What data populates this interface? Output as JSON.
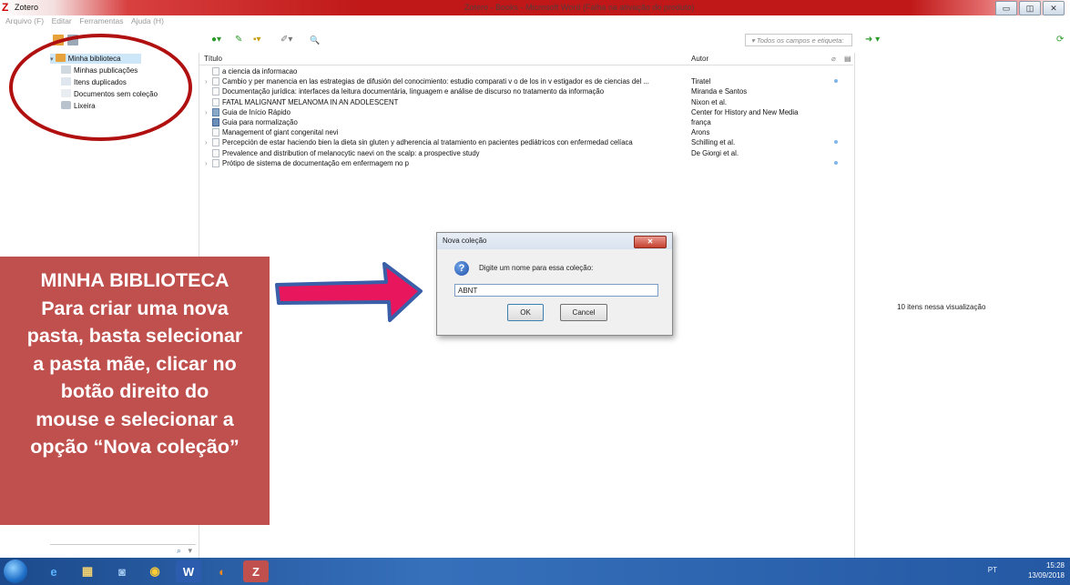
{
  "window": {
    "app_title": "Zotero",
    "doc_title": "Zotero - Books - Microsoft Word (Falha na ativação do produto)",
    "controls": [
      "▭",
      "◫",
      "✕"
    ]
  },
  "menu": [
    "Arquivo (F)",
    "Editar",
    "Ferramentas",
    "Ajuda (H)"
  ],
  "toolbar": {
    "search_placeholder": "▾ Todos os campos e etiqueta:",
    "new_item": "●▾",
    "add_by_id": "✎",
    "new_note": "▪▾",
    "attach": "✐▾",
    "advanced_search": "🔍",
    "sync": "➜ ▾",
    "sync_status": "⟳"
  },
  "library": {
    "root": "Minha biblioteca",
    "items": [
      "Minhas publicações",
      "Itens duplicados",
      "Documentos sem coleção",
      "Lixeira"
    ]
  },
  "columns": {
    "title": "Título",
    "author": "Autor"
  },
  "rows": [
    {
      "title": "a ciencia da informacao",
      "author": "",
      "expand": "",
      "dot": false,
      "icon": "doc"
    },
    {
      "title": "Cambio y per manencia en las estrategias de difusión del conocimiento: estudio comparati v o de los in v estigador es de ciencias del ...",
      "author": "Tiratel",
      "expand": "›",
      "dot": true,
      "icon": "doc"
    },
    {
      "title": "Documentação jurídica: interfaces da leitura documentária, linguagem e análise de discurso no tratamento da informação",
      "author": "Miranda e Santos",
      "expand": "",
      "dot": false,
      "icon": "doc"
    },
    {
      "title": "FATAL MALIGNANT MELANOMA IN AN ADOLESCENT",
      "author": "Nixon et al.",
      "expand": "",
      "dot": false,
      "icon": "doc"
    },
    {
      "title": "Guia de Início Rápido",
      "author": "Center for History and New Media",
      "expand": "›",
      "dot": false,
      "icon": "book"
    },
    {
      "title": "Guia para normalização",
      "author": "frança",
      "expand": "",
      "dot": false,
      "icon": "doc2"
    },
    {
      "title": "Management of giant congenital nevi",
      "author": "Arons",
      "expand": "",
      "dot": false,
      "icon": "doc"
    },
    {
      "title": "Percepción de estar haciendo bien la dieta sin gluten y adherencia al tratamiento en pacientes pediátricos con enfermedad celíaca",
      "author": "Schilling et al.",
      "expand": "›",
      "dot": true,
      "icon": "doc"
    },
    {
      "title": "Prevalence and distribution of melanocytic naevi on the scalp: a prospective study",
      "author": "De Giorgi et al.",
      "expand": "",
      "dot": false,
      "icon": "doc"
    },
    {
      "title": "Prótipo de sistema de documentação em enfermagem no p",
      "author": "",
      "expand": "›",
      "dot": true,
      "icon": "doc"
    }
  ],
  "right_pane": {
    "count": "10 itens nessa visualização"
  },
  "dialog": {
    "title": "Nova coleção",
    "close": "✕",
    "prompt": "Digite um nome para essa coleção:",
    "value": "ABNT",
    "ok": "OK",
    "cancel": "Cancel"
  },
  "annotation": {
    "text": "MINHA BIBLIOTECA\nPara criar uma nova\npasta, basta selecionar\na pasta mãe, clicar no\nbotão direito do\nmouse e selecionar a\nopção “Nova coleção”"
  },
  "taskbar": {
    "apps": [
      "e",
      "▦",
      "◙",
      "◉",
      "W",
      "◐",
      "Z"
    ],
    "lang": "PT",
    "time": "15:28",
    "date": "13/09/2018"
  },
  "colors": {
    "accent": "#c0504d",
    "titlebar": "#c01818",
    "arrow": "#e8175d",
    "ellipse": "#b01010"
  }
}
